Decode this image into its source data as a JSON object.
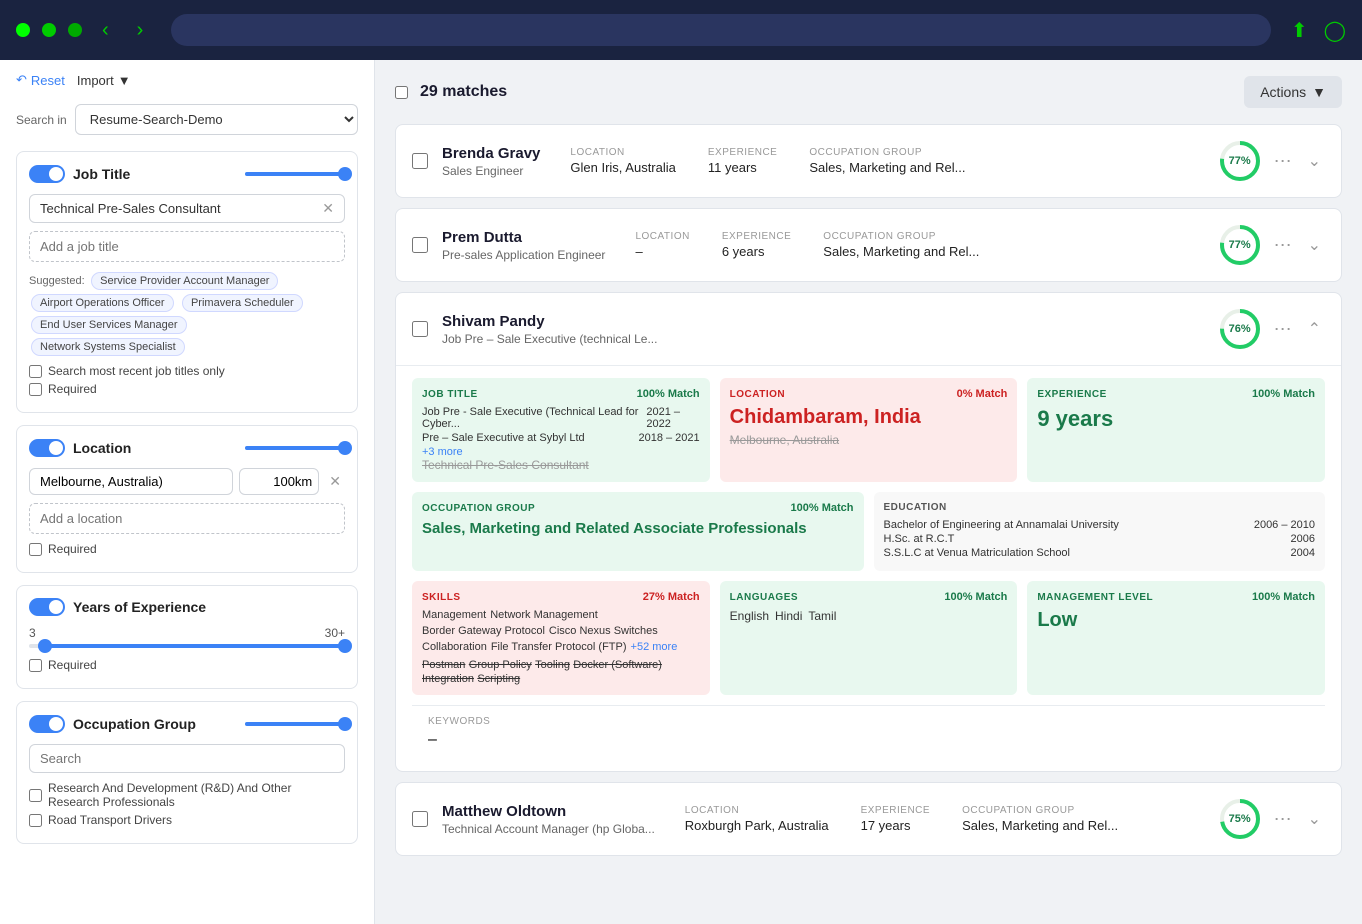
{
  "topbar": {
    "dots": [
      "green1",
      "green2",
      "green3"
    ],
    "nav_back": "‹",
    "nav_forward": "›",
    "upload_icon": "⬆",
    "user_icon": "👤"
  },
  "sidebar": {
    "reset_label": "Reset",
    "import_label": "Import",
    "search_in_label": "Search in",
    "search_in_value": "Resume-Search-Demo",
    "filters": {
      "job_title": {
        "label": "Job Title",
        "current_value": "Technical Pre-Sales Consultant",
        "placeholder": "Add a job title",
        "suggested_label": "Suggested:",
        "suggestions": [
          "Service Provider Account Manager",
          "Airport Operations Officer",
          "Primavera Scheduler",
          "End User Services Manager",
          "Network Systems Specialist"
        ],
        "checkbox_recent": "Search most recent job titles only",
        "checkbox_required": "Required"
      },
      "location": {
        "label": "Location",
        "current_value": "Melbourne, Australia)",
        "km_value": "100km",
        "placeholder": "Add a location",
        "checkbox_required": "Required"
      },
      "experience": {
        "label": "Years of Experience",
        "min": "3",
        "max": "30+",
        "checkbox_required": "Required"
      },
      "occupation_group": {
        "label": "Occupation Group",
        "search_placeholder": "Search",
        "items": [
          "Research And Development (R&D) And Other Research Professionals",
          "Road Transport Drivers"
        ]
      }
    }
  },
  "results": {
    "matches_count": "29 matches",
    "actions_label": "Actions",
    "candidates": [
      {
        "id": "brenda-gravy",
        "name": "Brenda Gravy",
        "title": "Sales Engineer",
        "location_label": "LOCATION",
        "location": "Glen Iris, Australia",
        "experience_label": "EXPERIENCE",
        "experience": "11 years",
        "occupation_label": "OCCUPATION GROUP",
        "occupation": "Sales, Marketing and Rel...",
        "score": "77%",
        "score_value": 77,
        "expanded": false
      },
      {
        "id": "prem-dutta",
        "name": "Prem Dutta",
        "title": "Pre-sales Application Engineer",
        "location_label": "LOCATION",
        "location": "–",
        "experience_label": "EXPERIENCE",
        "experience": "6 years",
        "occupation_label": "OCCUPATION GROUP",
        "occupation": "Sales, Marketing and Rel...",
        "score": "77%",
        "score_value": 77,
        "expanded": false
      },
      {
        "id": "shivam-pandy",
        "name": "Shivam Pandy",
        "title": "Job Pre – Sale Executive (technical Le...",
        "score": "76%",
        "score_value": 76,
        "expanded": true,
        "details": {
          "job_title": {
            "label": "JOB TITLE",
            "match": "100% Match",
            "type": "green",
            "entries": [
              {
                "title": "Job Pre - Sale Executive (Technical Lead for Cyber...",
                "years": "2021 – 2022"
              },
              {
                "title": "Pre – Sale Executive at Sybyl Ltd",
                "years": "2018 – 2021"
              }
            ],
            "more": "+3 more",
            "strikethrough": "Technical Pre-Sales Consultant"
          },
          "location": {
            "label": "LOCATION",
            "match": "0% Match",
            "type": "red",
            "value": "Chidambaram, India",
            "strikethrough": "Melbourne, Australia"
          },
          "experience": {
            "label": "EXPERIENCE",
            "match": "100% Match",
            "type": "green",
            "value": "9 years"
          },
          "occupation": {
            "label": "OCCUPATION GROUP",
            "match": "100% Match",
            "type": "green",
            "value": "Sales, Marketing and Related Associate Professionals"
          },
          "education": {
            "label": "EDUCATION",
            "entries": [
              {
                "name": "Bachelor of Engineering at Annamalai University",
                "years": "2006 – 2010"
              },
              {
                "name": "H.Sc. at R.C.T",
                "years": "2006"
              },
              {
                "name": "S.S.L.C at Venua Matriculation School",
                "years": "2004"
              }
            ]
          },
          "skills": {
            "label": "SKILLS",
            "match": "27% Match",
            "type": "red",
            "skills": [
              "Management",
              "Network Management",
              "Border Gateway Protocol",
              "Cisco Nexus Switches",
              "Collaboration",
              "File Transfer Protocol (FTP)"
            ],
            "more": "+52 more",
            "strikethrough_skills": [
              "Postman",
              "Group Policy",
              "Tooling",
              "Docker (Software)",
              "Integration",
              "Scripting"
            ]
          },
          "languages": {
            "label": "LANGUAGES",
            "match": "100% Match",
            "type": "green",
            "langs": [
              "English",
              "Hindi",
              "Tamil"
            ]
          },
          "management": {
            "label": "MANAGEMENT LEVEL",
            "match": "100% Match",
            "type": "green",
            "value": "Low"
          },
          "keywords": {
            "label": "KEYWORDS",
            "value": "–"
          }
        }
      },
      {
        "id": "matthew-oldtown",
        "name": "Matthew Oldtown",
        "title": "Technical Account Manager (hp Globa...",
        "location_label": "LOCATION",
        "location": "Roxburgh Park, Australia",
        "experience_label": "EXPERIENCE",
        "experience": "17 years",
        "occupation_label": "OCCUPATION GROUP",
        "occupation": "Sales, Marketing and Rel...",
        "score": "75%",
        "score_value": 75,
        "expanded": false
      }
    ]
  }
}
